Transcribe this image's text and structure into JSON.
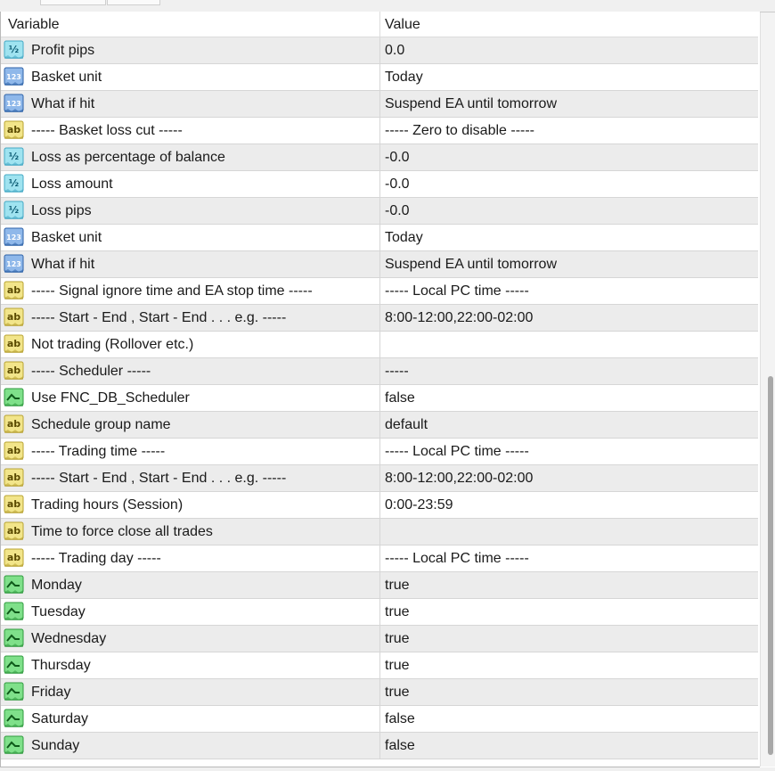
{
  "header": {
    "variable_label": "Variable",
    "value_label": "Value"
  },
  "icon_types": {
    "double": {
      "name": "fraction-icon",
      "glyph": "½",
      "bg": "#9fe3f0",
      "border": "#43a8c4",
      "color": "#0b5b73"
    },
    "int": {
      "name": "numeric-123-icon",
      "glyph": "123",
      "bg": "#8fb8ea",
      "border": "#2e62a8",
      "color": "#ffffff"
    },
    "string": {
      "name": "text-ab-icon",
      "glyph": "ab",
      "bg": "#f2e58a",
      "border": "#b8a332",
      "color": "#5a4a00"
    },
    "bool": {
      "name": "toggle-switch-icon",
      "glyph": "",
      "bg": "#7fe08a",
      "border": "#2f9a3e",
      "color": "#0f5a1a"
    }
  },
  "rows": [
    {
      "type": "double",
      "name": "Profit pips",
      "value": "0.0"
    },
    {
      "type": "int",
      "name": "Basket unit",
      "value": "Today"
    },
    {
      "type": "int",
      "name": "What if hit",
      "value": "Suspend EA until tomorrow"
    },
    {
      "type": "string",
      "name": "----- Basket loss cut -----",
      "value": "----- Zero to disable -----"
    },
    {
      "type": "double",
      "name": "Loss as percentage of balance",
      "value": "-0.0"
    },
    {
      "type": "double",
      "name": "Loss amount",
      "value": "-0.0"
    },
    {
      "type": "double",
      "name": "Loss pips",
      "value": "-0.0"
    },
    {
      "type": "int",
      "name": "Basket unit",
      "value": "Today"
    },
    {
      "type": "int",
      "name": "What if hit",
      "value": "Suspend EA until tomorrow"
    },
    {
      "type": "string",
      "name": "----- Signal ignore time and EA stop time -----",
      "value": "----- Local PC time -----"
    },
    {
      "type": "string",
      "name": "----- Start - End , Start - End . . . e.g. -----",
      "value": "8:00-12:00,22:00-02:00"
    },
    {
      "type": "string",
      "name": "Not trading (Rollover etc.)",
      "value": ""
    },
    {
      "type": "string",
      "name": "----- Scheduler -----",
      "value": "-----"
    },
    {
      "type": "bool",
      "name": "Use FNC_DB_Scheduler",
      "value": "false"
    },
    {
      "type": "string",
      "name": "Schedule group name",
      "value": "default"
    },
    {
      "type": "string",
      "name": "----- Trading time -----",
      "value": "----- Local PC time -----"
    },
    {
      "type": "string",
      "name": "----- Start - End , Start - End . . . e.g. -----",
      "value": "8:00-12:00,22:00-02:00"
    },
    {
      "type": "string",
      "name": "Trading hours (Session)",
      "value": "0:00-23:59"
    },
    {
      "type": "string",
      "name": "Time to force close all trades",
      "value": ""
    },
    {
      "type": "string",
      "name": "----- Trading day -----",
      "value": "----- Local PC time -----"
    },
    {
      "type": "bool",
      "name": "Monday",
      "value": "true"
    },
    {
      "type": "bool",
      "name": "Tuesday",
      "value": "true"
    },
    {
      "type": "bool",
      "name": "Wednesday",
      "value": "true"
    },
    {
      "type": "bool",
      "name": "Thursday",
      "value": "true"
    },
    {
      "type": "bool",
      "name": "Friday",
      "value": "true"
    },
    {
      "type": "bool",
      "name": "Saturday",
      "value": "false"
    },
    {
      "type": "bool",
      "name": "Sunday",
      "value": "false"
    }
  ]
}
